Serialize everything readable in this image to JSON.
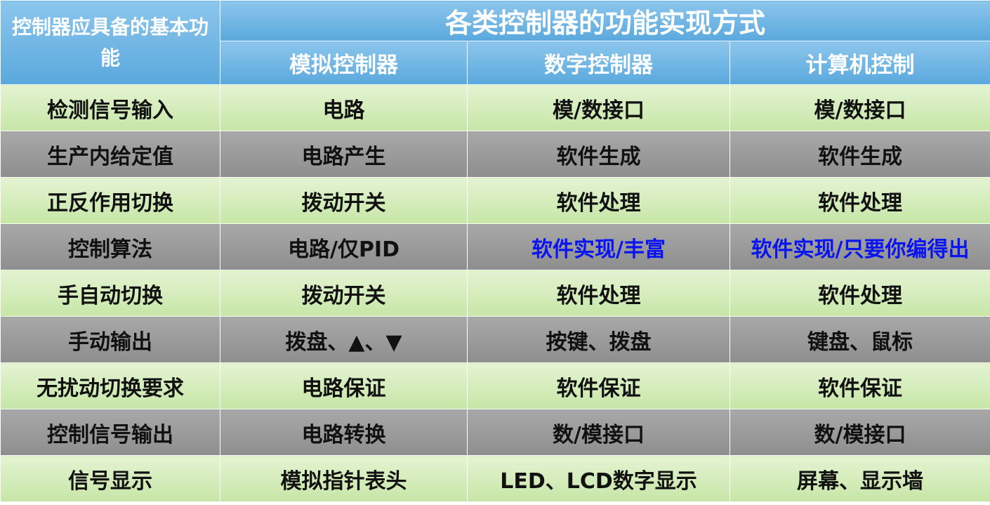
{
  "header": {
    "corner_label": "控制器应具备的基本功能",
    "title": "各类控制器的功能实现方式",
    "columns": [
      "模拟控制器",
      "数字控制器",
      "计算机控制"
    ]
  },
  "rows": [
    {
      "label": "检测信号输入",
      "cells": [
        "电路",
        "模/数接口",
        "模/数接口"
      ]
    },
    {
      "label": "生产内给定值",
      "cells": [
        "电路产生",
        "软件生成",
        "软件生成"
      ]
    },
    {
      "label": "正反作用切换",
      "cells": [
        "拨动开关",
        "软件处理",
        "软件处理"
      ]
    },
    {
      "label": "控制算法",
      "cells": [
        "电路/仅PID",
        "软件实现/丰富",
        "软件实现/只要你编得出"
      ]
    },
    {
      "label": "手自动切换",
      "cells": [
        "拨动开关",
        "软件处理",
        "软件处理"
      ]
    },
    {
      "label": "手动输出",
      "cells": [
        "拨盘、▲、▼",
        "按键、拨盘",
        "键盘、鼠标"
      ]
    },
    {
      "label": "无扰动切换要求",
      "cells": [
        "电路保证",
        "软件保证",
        "软件保证"
      ]
    },
    {
      "label": "控制信号输出",
      "cells": [
        "电路转换",
        "数/模接口",
        "数/模接口"
      ]
    },
    {
      "label": "信号显示",
      "cells": [
        "模拟指针表头",
        "LED、LCD数字显示",
        "屏幕、显示墙"
      ]
    }
  ],
  "colors": {
    "header_blue": "#5aa8dd",
    "row_green": "#c6e6a6",
    "row_gray": "#8e8e8e",
    "highlight_text_blue": "#0a14f0"
  }
}
